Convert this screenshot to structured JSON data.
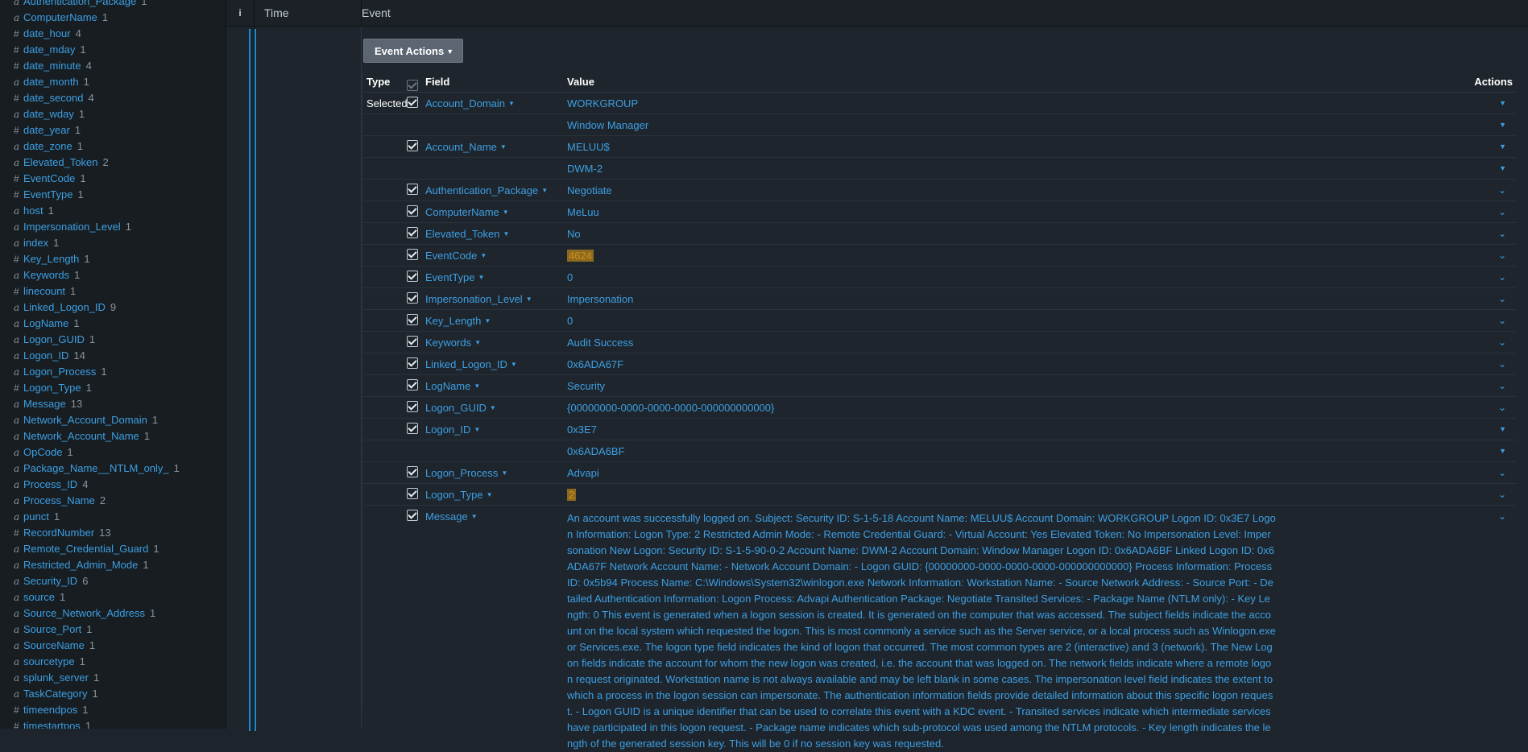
{
  "sidebar": {
    "fields": [
      {
        "type": "a",
        "name": "Authentication_Package",
        "count": "1"
      },
      {
        "type": "a",
        "name": "ComputerName",
        "count": "1"
      },
      {
        "type": "#",
        "name": "date_hour",
        "count": "4"
      },
      {
        "type": "#",
        "name": "date_mday",
        "count": "1"
      },
      {
        "type": "#",
        "name": "date_minute",
        "count": "4"
      },
      {
        "type": "a",
        "name": "date_month",
        "count": "1"
      },
      {
        "type": "#",
        "name": "date_second",
        "count": "4"
      },
      {
        "type": "a",
        "name": "date_wday",
        "count": "1"
      },
      {
        "type": "#",
        "name": "date_year",
        "count": "1"
      },
      {
        "type": "a",
        "name": "date_zone",
        "count": "1"
      },
      {
        "type": "a",
        "name": "Elevated_Token",
        "count": "2"
      },
      {
        "type": "#",
        "name": "EventCode",
        "count": "1"
      },
      {
        "type": "#",
        "name": "EventType",
        "count": "1"
      },
      {
        "type": "a",
        "name": "host",
        "count": "1"
      },
      {
        "type": "a",
        "name": "Impersonation_Level",
        "count": "1"
      },
      {
        "type": "a",
        "name": "index",
        "count": "1"
      },
      {
        "type": "#",
        "name": "Key_Length",
        "count": "1"
      },
      {
        "type": "a",
        "name": "Keywords",
        "count": "1"
      },
      {
        "type": "#",
        "name": "linecount",
        "count": "1"
      },
      {
        "type": "a",
        "name": "Linked_Logon_ID",
        "count": "9"
      },
      {
        "type": "a",
        "name": "LogName",
        "count": "1"
      },
      {
        "type": "a",
        "name": "Logon_GUID",
        "count": "1"
      },
      {
        "type": "a",
        "name": "Logon_ID",
        "count": "14"
      },
      {
        "type": "a",
        "name": "Logon_Process",
        "count": "1"
      },
      {
        "type": "#",
        "name": "Logon_Type",
        "count": "1"
      },
      {
        "type": "a",
        "name": "Message",
        "count": "13"
      },
      {
        "type": "a",
        "name": "Network_Account_Domain",
        "count": "1"
      },
      {
        "type": "a",
        "name": "Network_Account_Name",
        "count": "1"
      },
      {
        "type": "a",
        "name": "OpCode",
        "count": "1"
      },
      {
        "type": "a",
        "name": "Package_Name__NTLM_only_",
        "count": "1"
      },
      {
        "type": "a",
        "name": "Process_ID",
        "count": "4"
      },
      {
        "type": "a",
        "name": "Process_Name",
        "count": "2"
      },
      {
        "type": "a",
        "name": "punct",
        "count": "1"
      },
      {
        "type": "#",
        "name": "RecordNumber",
        "count": "13"
      },
      {
        "type": "a",
        "name": "Remote_Credential_Guard",
        "count": "1"
      },
      {
        "type": "a",
        "name": "Restricted_Admin_Mode",
        "count": "1"
      },
      {
        "type": "a",
        "name": "Security_ID",
        "count": "6"
      },
      {
        "type": "a",
        "name": "source",
        "count": "1"
      },
      {
        "type": "a",
        "name": "Source_Network_Address",
        "count": "1"
      },
      {
        "type": "a",
        "name": "Source_Port",
        "count": "1"
      },
      {
        "type": "a",
        "name": "SourceName",
        "count": "1"
      },
      {
        "type": "a",
        "name": "sourcetype",
        "count": "1"
      },
      {
        "type": "a",
        "name": "splunk_server",
        "count": "1"
      },
      {
        "type": "a",
        "name": "TaskCategory",
        "count": "1"
      },
      {
        "type": "#",
        "name": "timeendpos",
        "count": "1"
      },
      {
        "type": "#",
        "name": "timestartpos",
        "count": "1"
      }
    ]
  },
  "header": {
    "info": "i",
    "time": "Time",
    "event": "Event"
  },
  "event_actions_label": "Event Actions",
  "table": {
    "col_type": "Type",
    "col_field": "Field",
    "col_value": "Value",
    "col_actions": "Actions",
    "selected_label": "Selected",
    "rows": [
      {
        "field": "Account_Domain",
        "values": [
          "WORKGROUP",
          "Window Manager"
        ]
      },
      {
        "field": "Account_Name",
        "values": [
          "MELUU$",
          "DWM-2"
        ]
      },
      {
        "field": "Authentication_Package",
        "values": [
          "Negotiate"
        ]
      },
      {
        "field": "ComputerName",
        "values": [
          "MeLuu"
        ]
      },
      {
        "field": "Elevated_Token",
        "values": [
          "No"
        ]
      },
      {
        "field": "EventCode",
        "values": [
          "4624"
        ],
        "highlight": true
      },
      {
        "field": "EventType",
        "values": [
          "0"
        ]
      },
      {
        "field": "Impersonation_Level",
        "values": [
          "Impersonation"
        ]
      },
      {
        "field": "Key_Length",
        "values": [
          "0"
        ]
      },
      {
        "field": "Keywords",
        "values": [
          "Audit Success"
        ]
      },
      {
        "field": "Linked_Logon_ID",
        "values": [
          "0x6ADA67F"
        ]
      },
      {
        "field": "LogName",
        "values": [
          "Security"
        ]
      },
      {
        "field": "Logon_GUID",
        "values": [
          "{00000000-0000-0000-0000-000000000000}"
        ]
      },
      {
        "field": "Logon_ID",
        "values": [
          "0x3E7",
          "0x6ADA6BF"
        ]
      },
      {
        "field": "Logon_Process",
        "values": [
          "Advapi"
        ]
      },
      {
        "field": "Logon_Type",
        "values": [
          "2"
        ],
        "highlight": true
      }
    ],
    "message_field": "Message",
    "message_value": "An account was successfully logged on. Subject: Security ID: S-1-5-18 Account Name: MELUU$ Account Domain: WORKGROUP Logon ID: 0x3E7 Logon Information: Logon Type: 2 Restricted Admin Mode: - Remote Credential Guard: - Virtual Account: Yes Elevated Token: No Impersonation Level: Impersonation New Logon: Security ID: S-1-5-90-0-2 Account Name: DWM-2 Account Domain: Window Manager Logon ID: 0x6ADA6BF Linked Logon ID: 0x6ADA67F Network Account Name: - Network Account Domain: - Logon GUID: {00000000-0000-0000-0000-000000000000} Process Information: Process ID: 0x5b94 Process Name: C:\\Windows\\System32\\winlogon.exe Network Information: Workstation Name: - Source Network Address: - Source Port: - Detailed Authentication Information: Logon Process: Advapi Authentication Package: Negotiate Transited Services: - Package Name (NTLM only): - Key Length: 0 This event is generated when a logon session is created. It is generated on the computer that was accessed. The subject fields indicate the account on the local system which requested the logon. This is most commonly a service such as the Server service, or a local process such as Winlogon.exe or Services.exe. The logon type field indicates the kind of logon that occurred. The most common types are 2 (interactive) and 3 (network). The New Logon fields indicate the account for whom the new logon was created, i.e. the account that was logged on. The network fields indicate where a remote logon request originated. Workstation name is not always available and may be left blank in some cases. The impersonation level field indicates the extent to which a process in the logon session can impersonate. The authentication information fields provide detailed information about this specific logon request. - Logon GUID is a unique identifier that can be used to correlate this event with a KDC event. - Transited services indicate which intermediate services have participated in this logon request. - Package name indicates which sub-protocol was used among the NTLM protocols. - Key length indicates the length of the generated session key. This will be 0 if no session key was requested."
  },
  "colors": {
    "accent": "#3d9fe3",
    "highlight_bg": "#8a6a1f",
    "highlight_fg": "#d98c1a"
  }
}
